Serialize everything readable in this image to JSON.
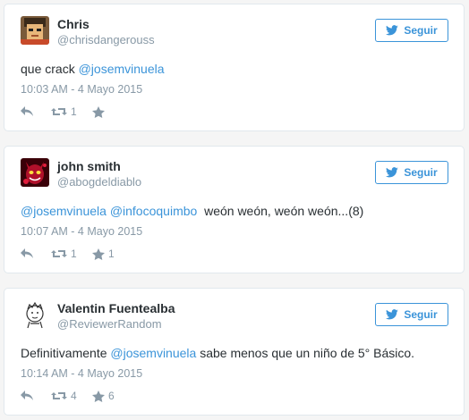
{
  "colors": {
    "link": "#3b94d9",
    "muted": "#8899a6",
    "text": "#292f33",
    "border": "#e1e8ed",
    "background": "#f5f5f5"
  },
  "tweets": [
    {
      "name": "Chris",
      "handle": "@chrisdangerouss",
      "follow_label": "Seguir",
      "text_parts": [
        {
          "t": "que crack ",
          "mention": false
        },
        {
          "t": "@josemvinuela",
          "mention": true
        }
      ],
      "time": "10:03 AM - 4 Mayo 2015",
      "retweets": "1",
      "favorites": "",
      "avatar_icon": "pixel-face-avatar"
    },
    {
      "name": "john smith",
      "handle": "@abogdeldiablo",
      "follow_label": "Seguir",
      "text_parts": [
        {
          "t": "@josemvinuela",
          "mention": true
        },
        {
          "t": " ",
          "mention": false
        },
        {
          "t": "@infocoquimbo",
          "mention": true
        },
        {
          "t": "  weón weón, weón weón...(8)",
          "mention": false
        }
      ],
      "time": "10:07 AM - 4 Mayo 2015",
      "retweets": "1",
      "favorites": "1",
      "avatar_icon": "red-devil-avatar"
    },
    {
      "name": "Valentin Fuentealba",
      "handle": "@ReviewerRandom",
      "follow_label": "Seguir",
      "text_parts": [
        {
          "t": "Definitivamente ",
          "mention": false
        },
        {
          "t": "@josemvinuela",
          "mention": true
        },
        {
          "t": " sabe menos que un niño de 5° Básico.",
          "mention": false
        }
      ],
      "time": "10:14 AM - 4 Mayo 2015",
      "retweets": "4",
      "favorites": "6",
      "avatar_icon": "sketch-face-avatar"
    }
  ]
}
